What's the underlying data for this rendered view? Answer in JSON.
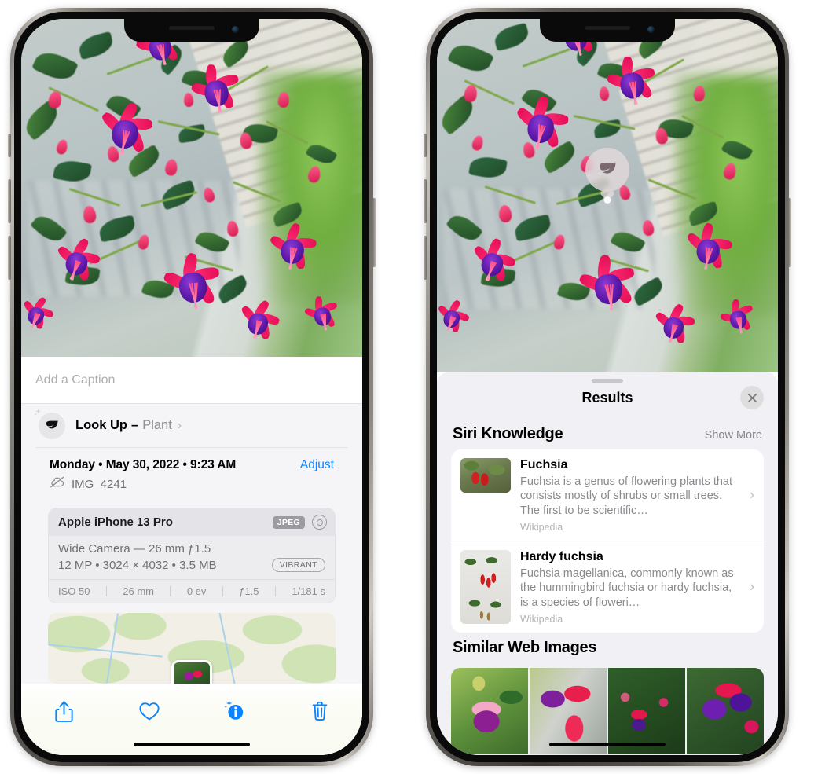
{
  "meta": {
    "accent_blue": "#0a84ff",
    "sheet_bg": "#f1f1f5",
    "panel_bg": "#f5f5f7"
  },
  "left_phone": {
    "caption": {
      "placeholder": "Add a Caption",
      "value": ""
    },
    "lookup": {
      "icon": "leaf-icon",
      "sparkle": "sparkles-icon",
      "label": "Look Up",
      "dash": "–",
      "subject": "Plant",
      "chevron": "›"
    },
    "date_row": {
      "date_text": "Monday • May 30, 2022 • 9:23 AM",
      "adjust_label": "Adjust"
    },
    "file_row": {
      "icon": "cloud-slash-icon",
      "filename": "IMG_4241"
    },
    "camera_card": {
      "device": "Apple iPhone 13 Pro",
      "format_badge": "JPEG",
      "raw_icon": "raw-target-icon",
      "lens_line": "Wide Camera — 26 mm ƒ1.5",
      "size_line": "12 MP • 3024 × 4032 • 3.5 MB",
      "style_pill": "VIBRANT",
      "exif": [
        "ISO 50",
        "26 mm",
        "0 ev",
        "ƒ1.5",
        "1/181 s"
      ]
    },
    "toolbar": [
      {
        "name": "share-button",
        "icon": "share-icon"
      },
      {
        "name": "favorite-button",
        "icon": "heart-icon"
      },
      {
        "name": "info-button",
        "icon": "info-sparkle-icon"
      },
      {
        "name": "delete-button",
        "icon": "trash-icon"
      }
    ]
  },
  "right_phone": {
    "visual_lookup_badge": {
      "icon": "leaf-icon"
    },
    "sheet": {
      "title": "Results",
      "close_icon": "close-icon",
      "grabber": "drag-handle"
    },
    "siri_knowledge": {
      "title": "Siri Knowledge",
      "show_more": "Show More",
      "items": [
        {
          "title": "Fuchsia",
          "description": "Fuchsia is a genus of flowering plants that consists mostly of shrubs or small trees. The first to be scientific…",
          "source": "Wikipedia",
          "thumb": "fuchsia-red-thumb",
          "chevron": "›"
        },
        {
          "title": "Hardy fuchsia",
          "description": "Fuchsia magellanica, commonly known as the hummingbird fuchsia or hardy fuchsia, is a species of floweri…",
          "source": "Wikipedia",
          "thumb": "hardy-fuchsia-herbarium-thumb",
          "chevron": "›"
        }
      ]
    },
    "similar_web_images": {
      "title": "Similar Web Images",
      "items": [
        {
          "name": "web-image-1"
        },
        {
          "name": "web-image-2"
        },
        {
          "name": "web-image-3"
        },
        {
          "name": "web-image-4"
        }
      ]
    }
  }
}
